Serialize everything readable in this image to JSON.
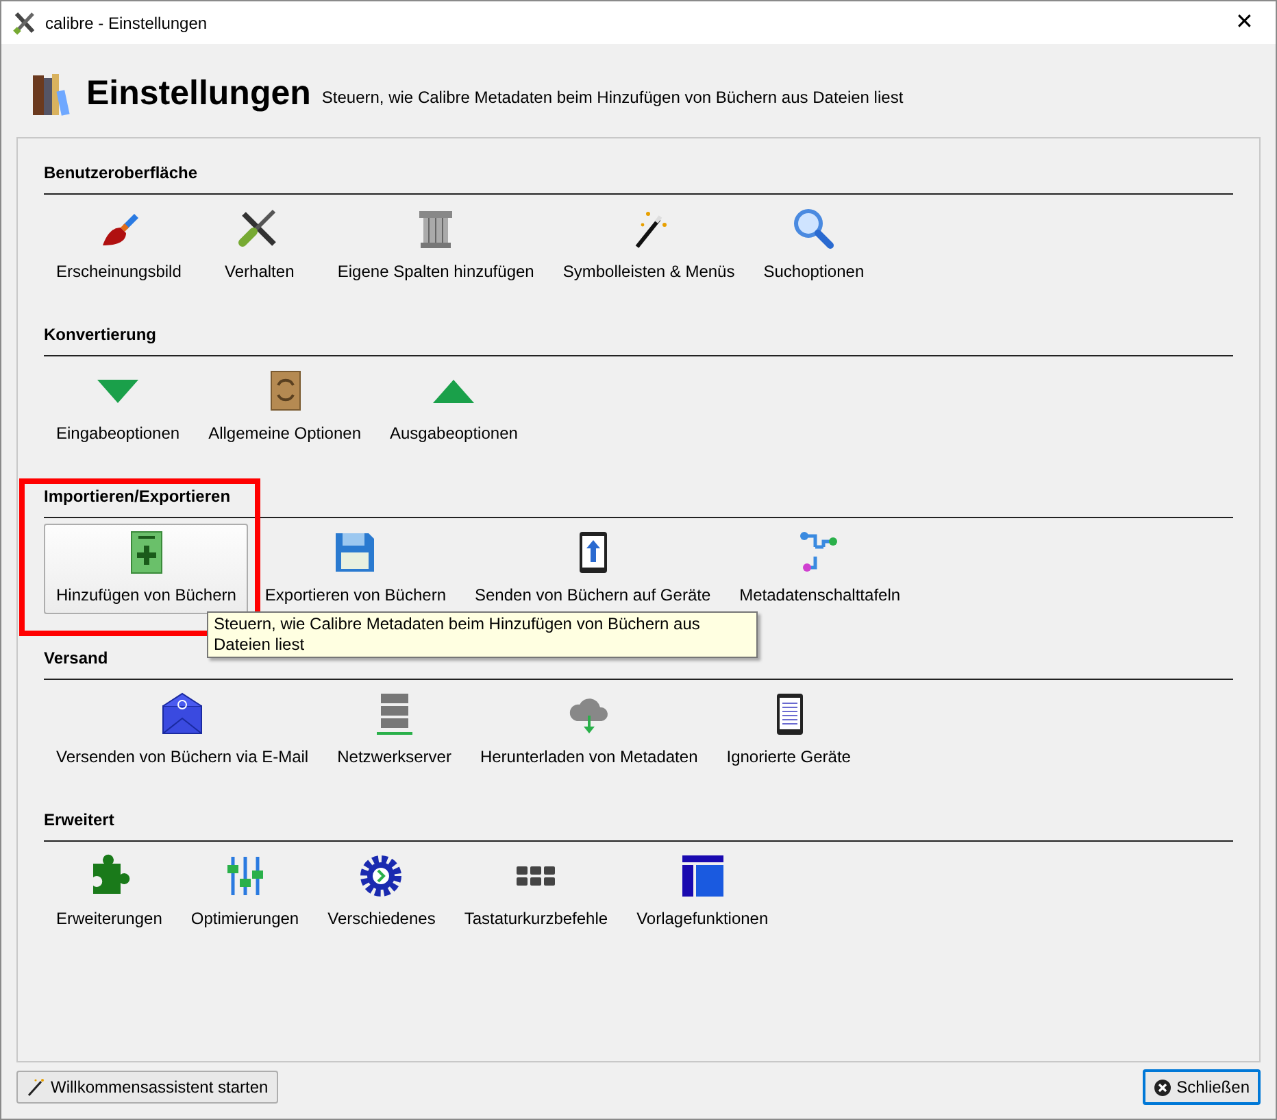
{
  "window": {
    "title": "calibre - Einstellungen",
    "close_glyph": "✕"
  },
  "header": {
    "title": "Einstellungen",
    "description": "Steuern, wie Calibre Metadaten beim Hinzufügen von Büchern aus Dateien liest"
  },
  "sections": [
    {
      "title": "Benutzeroberfläche",
      "items": [
        {
          "label": "Erscheinungsbild",
          "hovered": false
        },
        {
          "label": "Verhalten",
          "hovered": false
        },
        {
          "label": "Eigene Spalten hinzufügen",
          "hovered": false
        },
        {
          "label": "Symbolleisten & Menüs",
          "hovered": false
        },
        {
          "label": "Suchoptionen",
          "hovered": false
        }
      ]
    },
    {
      "title": "Konvertierung",
      "items": [
        {
          "label": "Eingabeoptionen",
          "hovered": false
        },
        {
          "label": "Allgemeine Optionen",
          "hovered": false
        },
        {
          "label": "Ausgabeoptionen",
          "hovered": false
        }
      ]
    },
    {
      "title": "Importieren/Exportieren",
      "items": [
        {
          "label": "Hinzufügen von Büchern",
          "hovered": true
        },
        {
          "label": "Exportieren von Büchern",
          "hovered": false
        },
        {
          "label": "Senden von Büchern auf Geräte",
          "hovered": false
        },
        {
          "label": "Metadatenschalttafeln",
          "hovered": false
        }
      ]
    },
    {
      "title": "Versand",
      "items": [
        {
          "label": "Versenden von Büchern via E-Mail",
          "hovered": false
        },
        {
          "label": "Netzwerkserver",
          "hovered": false
        },
        {
          "label": "Herunterladen von Metadaten",
          "hovered": false
        },
        {
          "label": "Ignorierte Geräte",
          "hovered": false
        }
      ]
    },
    {
      "title": "Erweitert",
      "items": [
        {
          "label": "Erweiterungen",
          "hovered": false
        },
        {
          "label": "Optimierungen",
          "hovered": false
        },
        {
          "label": "Verschiedenes",
          "hovered": false
        },
        {
          "label": "Tastaturkurzbefehle",
          "hovered": false
        },
        {
          "label": "Vorlagefunktionen",
          "hovered": false
        }
      ]
    }
  ],
  "tooltip": {
    "text": "Steuern, wie Calibre Metadaten beim Hinzufügen von Büchern aus Dateien liest"
  },
  "highlight_frame": true,
  "footer": {
    "wizard_button": "Willkommensassistent starten",
    "close_button": {
      "label": "Schließen",
      "focused": true
    }
  }
}
